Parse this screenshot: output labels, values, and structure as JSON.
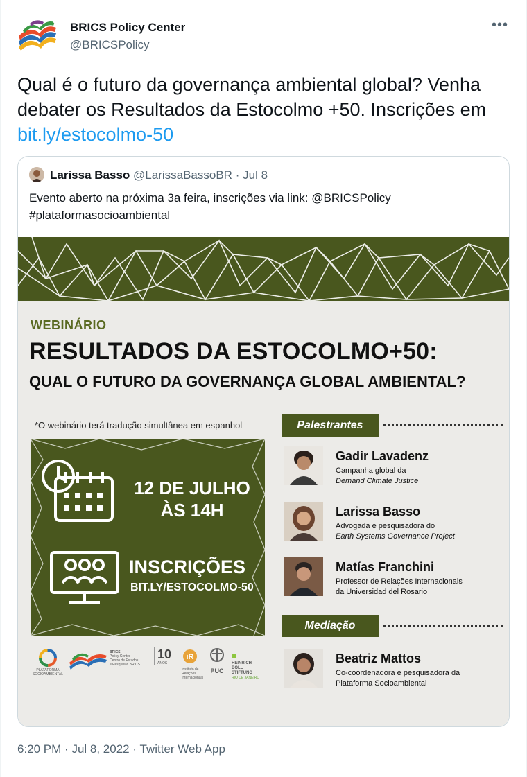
{
  "author": {
    "name": "BRICS Policy Center",
    "handle": "@BRICSPolicy"
  },
  "tweet": {
    "text_before_link": "Qual é o futuro da governança ambiental global? Venha debater os Resultados da Estocolmo +50. Inscrições em ",
    "link": "bit.ly/estocolmo-50"
  },
  "quoted": {
    "name": "Larissa Basso",
    "handle": "@LarissaBassoBR",
    "separator": "·",
    "date": "Jul 8",
    "text_line1": "Evento aberto na próxima 3a feira, inscrições via link: @BRICSPolicy",
    "text_line2": "#plataformasocioambiental"
  },
  "poster": {
    "kicker": "WEBINÁRIO",
    "title": "RESULTADOS DA ESTOCOLMO+50:",
    "subtitle": "QUAL O FUTURO DA GOVERNANÇA GLOBAL AMBIENTAL?",
    "note": "*O webinário terá tradução simultânea em espanhol",
    "date_line1": "12 DE JULHO",
    "date_line2": "ÀS 14H",
    "registration_title": "INSCRIÇÕES",
    "registration_link": "BIT.LY/ESTOCOLMO-50",
    "speakers_tag": "Palestrantes",
    "moderation_tag": "Mediação",
    "speakers": [
      {
        "name": "Gadir Lavadenz",
        "role_line1": "Campanha global da",
        "role_line2": "Demand Climate Justice"
      },
      {
        "name": "Larissa Basso",
        "role_line1": "Advogada e pesquisadora do",
        "role_line2": "Earth Systems Governance Project"
      },
      {
        "name": "Matías Franchini",
        "role_line1": "Professor de Relações Internacionais",
        "role_line2": "da Universidad del Rosario"
      }
    ],
    "moderator": {
      "name": "Beatriz Mattos",
      "role_line1": "Co-coordenadora e pesquisadora da",
      "role_line2": "Plataforma Socioambiental"
    },
    "logos": {
      "plataforma": "PLATAFORMA SOCIOAMBIENTAL",
      "brics_line1": "BRICS",
      "brics_line2": "Policy Center",
      "brics_line3": "Centro de Estudos",
      "brics_line4": "e Pesquisas BRICS",
      "ten_years": "10",
      "ten_years_label": "ANOS",
      "iri": "Instituto de Relações Internacionais",
      "puc": "PUC",
      "hbs_line1": "HEINRICH",
      "hbs_line2": "BÖLL",
      "hbs_line3": "STIFTUNG",
      "hbs_line4": "RIO DE JANEIRO"
    }
  },
  "meta": {
    "time": "6:20 PM",
    "separator": "·",
    "date": "Jul 8, 2022",
    "source": "Twitter Web App"
  },
  "colors": {
    "link": "#1d9bf0",
    "poster_green": "#49571e",
    "muted": "#536471"
  }
}
